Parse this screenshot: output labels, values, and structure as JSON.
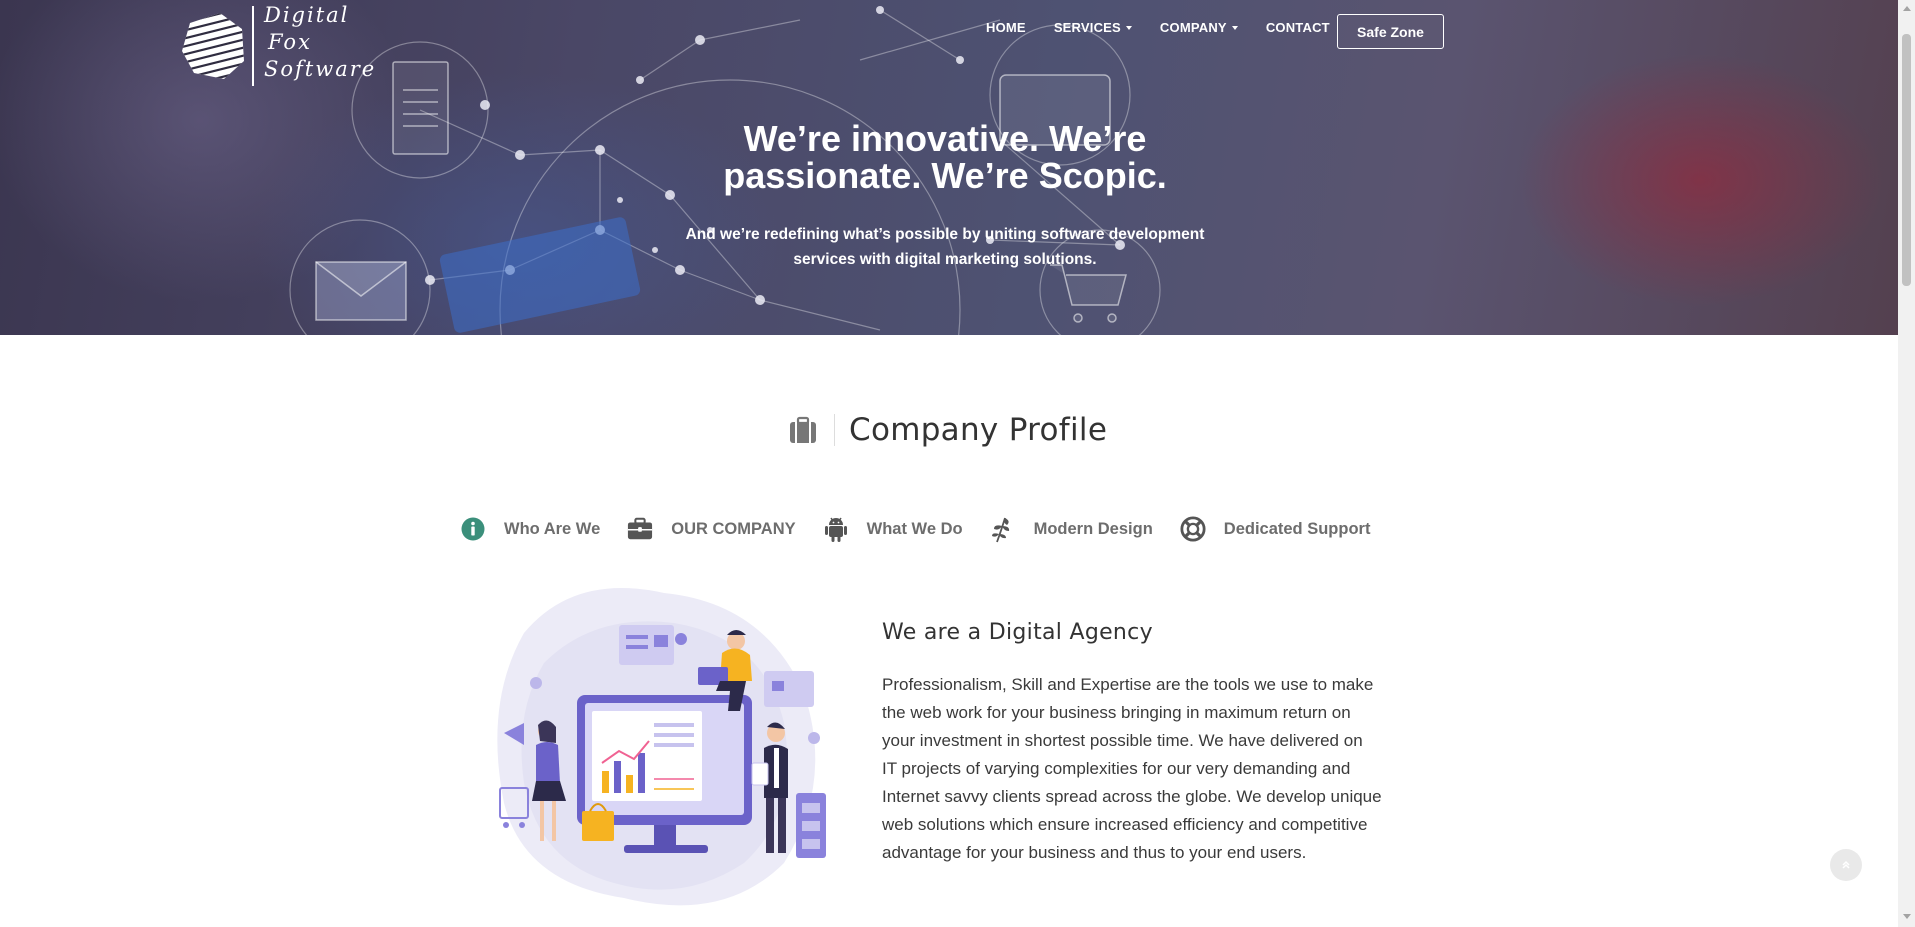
{
  "logo": {
    "lines": [
      "Digital",
      "Fox",
      "Software"
    ],
    "icon": "striped-sphere-logo-icon"
  },
  "nav": {
    "items": [
      {
        "label": "HOME",
        "dropdown": false
      },
      {
        "label": "SERVICES",
        "dropdown": true
      },
      {
        "label": "COMPANY",
        "dropdown": true
      },
      {
        "label": "CONTACT",
        "dropdown": false
      }
    ],
    "cta_label": "Safe Zone"
  },
  "hero": {
    "title_line1": "We’re innovative. We’re",
    "title_line2": "passionate. We’re Scopic.",
    "subtitle_line1": "And we’re redefining what’s possible by uniting software development",
    "subtitle_line2": "services with digital marketing solutions."
  },
  "section": {
    "title": "Company Profile",
    "icon": "briefcase-icon"
  },
  "tabs": [
    {
      "label": "Who Are We",
      "icon": "info-circle-icon",
      "active": true
    },
    {
      "label": "OUR COMPANY",
      "icon": "briefcase-icon",
      "active": false
    },
    {
      "label": "What We Do",
      "icon": "android-icon",
      "active": false
    },
    {
      "label": "Modern Design",
      "icon": "leaf-icon",
      "active": false
    },
    {
      "label": "Dedicated Support",
      "icon": "life-ring-icon",
      "active": false
    }
  ],
  "content": {
    "title": "We are a Digital Agency",
    "body": "Professionalism, Skill and Expertise are the tools we use to make the web work for your business bringing in maximum return on your investment in shortest possible time. We have delivered on IT projects of varying complexities for our very demanding and Internet savvy clients spread across the globe. We develop unique web solutions which ensure increased efficiency and competitive advantage for your business and thus to your end users."
  },
  "colors": {
    "accent": "#3b8f7b",
    "tab_text": "#6d6d6d",
    "icon_gray": "#555555"
  }
}
